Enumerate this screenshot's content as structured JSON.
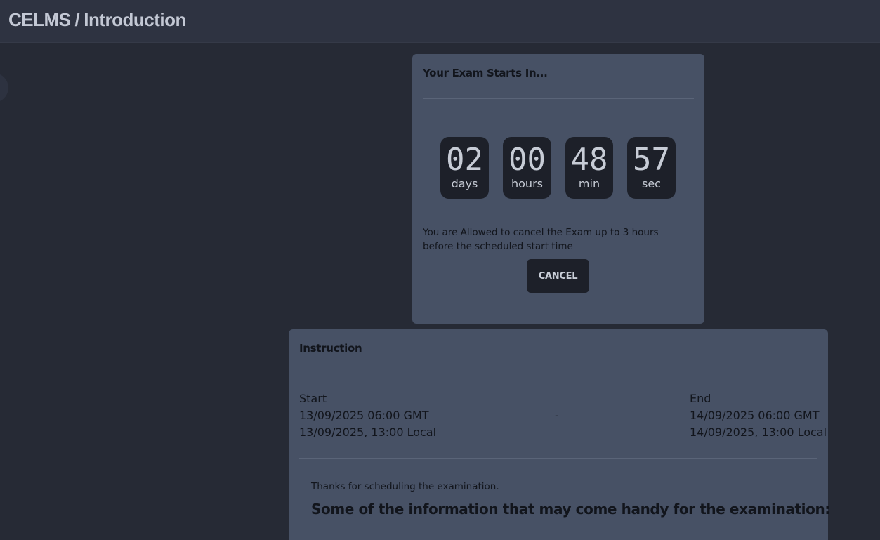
{
  "header": {
    "app_name": "CELMS",
    "separator": "/",
    "page": "Introduction"
  },
  "exam_card": {
    "title": "Your Exam Starts In...",
    "countdown": {
      "days": "02",
      "days_label": "days",
      "hours": "00",
      "hours_label": "hours",
      "minutes": "48",
      "minutes_label": "min",
      "seconds": "57",
      "seconds_label": "sec"
    },
    "cancel_note": "You are Allowed to cancel the Exam up to 3 hours before the scheduled start time",
    "cancel_label": "CANCEL"
  },
  "instruction": {
    "title": "Instruction",
    "start_label": "Start",
    "start_gmt": "13/09/2025 06:00 GMT",
    "start_local": "13/09/2025, 13:00 Local",
    "dash": "-",
    "end_label": "End",
    "end_gmt": "14/09/2025 06:00 GMT",
    "end_local": "14/09/2025, 13:00 Local",
    "thanks": "Thanks for scheduling the examination.",
    "handy_heading": "Some of the information that may come handy for the examination:"
  }
}
